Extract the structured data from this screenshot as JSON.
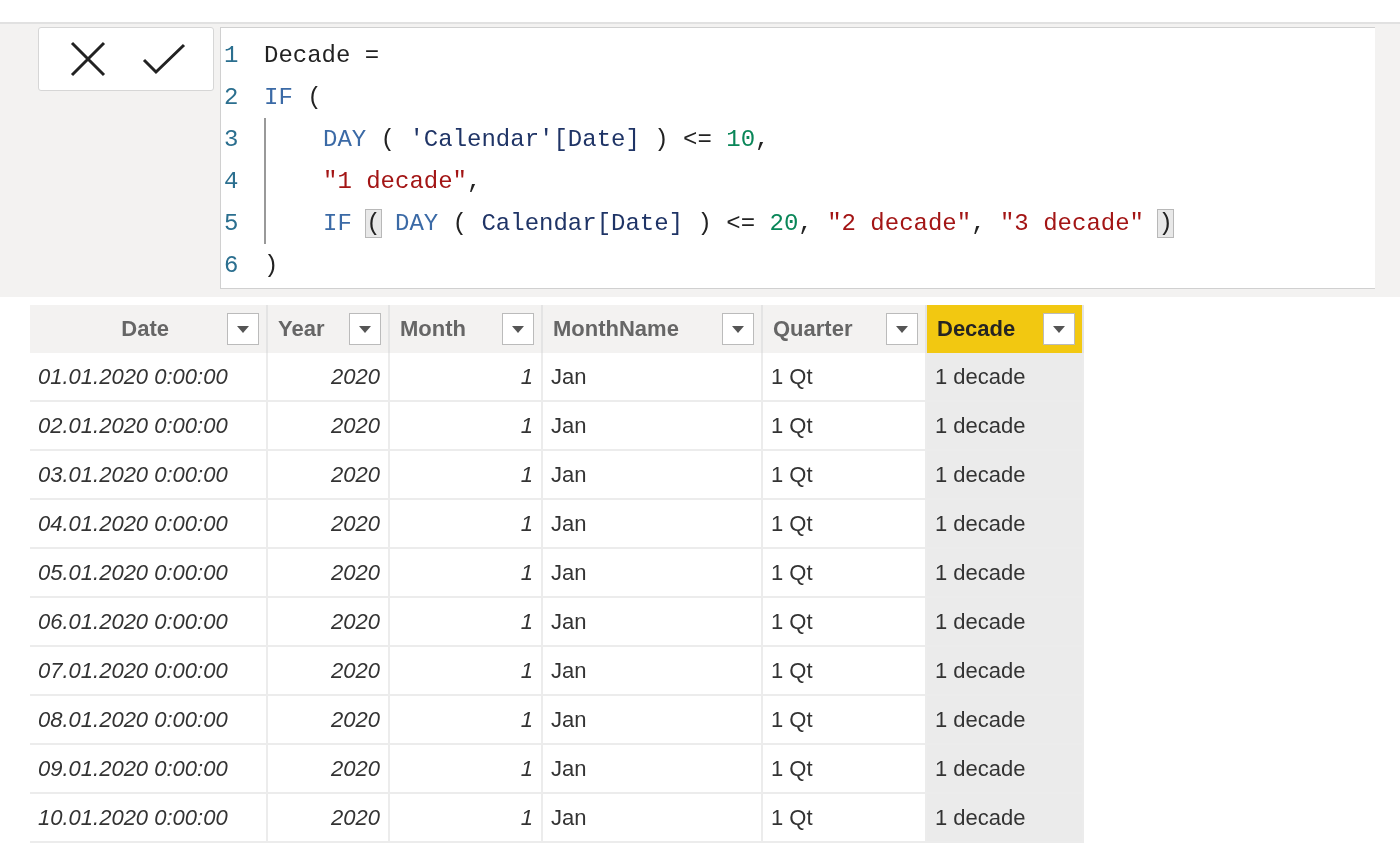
{
  "formula_bar": {
    "buttons": [
      {
        "kind": "cancel"
      },
      {
        "kind": "commit"
      }
    ],
    "lines": [
      {
        "number": "1",
        "guide": false,
        "tokens": [
          {
            "text": "Decade =",
            "kind": "text"
          }
        ]
      },
      {
        "number": "2",
        "guide": false,
        "tokens": [
          {
            "text": "IF",
            "kind": "keyword"
          },
          {
            "text": " (",
            "kind": "text"
          }
        ]
      },
      {
        "number": "3",
        "guide": true,
        "tokens": [
          {
            "text": "DAY",
            "kind": "keyword"
          },
          {
            "text": " ( ",
            "kind": "text"
          },
          {
            "text": "'Calendar'[Date]",
            "kind": "identifier"
          },
          {
            "text": " ) <= ",
            "kind": "text"
          },
          {
            "text": "10",
            "kind": "number"
          },
          {
            "text": ",",
            "kind": "text"
          }
        ]
      },
      {
        "number": "4",
        "guide": true,
        "tokens": [
          {
            "text": "\"1 decade\"",
            "kind": "string"
          },
          {
            "text": ",",
            "kind": "text"
          }
        ]
      },
      {
        "number": "5",
        "guide": true,
        "tokens": [
          {
            "text": "IF",
            "kind": "keyword"
          },
          {
            "text": "(",
            "kind": "bracket"
          },
          {
            "text": "DAY",
            "kind": "keyword"
          },
          {
            "text": " ( ",
            "kind": "text"
          },
          {
            "text": "Calendar[Date]",
            "kind": "identifier"
          },
          {
            "text": " ) <= ",
            "kind": "text"
          },
          {
            "text": "20",
            "kind": "number"
          },
          {
            "text": ", ",
            "kind": "text"
          },
          {
            "text": "\"2 decade\"",
            "kind": "string"
          },
          {
            "text": ", ",
            "kind": "text"
          },
          {
            "text": "\"3 decade\"",
            "kind": "string"
          },
          {
            "text": ")",
            "kind": "bracket"
          }
        ]
      },
      {
        "number": "6",
        "guide": false,
        "tokens": [
          {
            "text": ")",
            "kind": "text"
          }
        ]
      }
    ]
  },
  "table": {
    "columns": [
      {
        "label": "Date",
        "selected": false
      },
      {
        "label": "Year",
        "selected": false
      },
      {
        "label": "Month",
        "selected": false
      },
      {
        "label": "MonthName",
        "selected": false
      },
      {
        "label": "Quarter",
        "selected": false
      },
      {
        "label": "Decade",
        "selected": true
      }
    ],
    "rows": [
      [
        "01.01.2020 0:00:00",
        "2020",
        "1",
        "Jan",
        "1 Qt",
        "1 decade"
      ],
      [
        "02.01.2020 0:00:00",
        "2020",
        "1",
        "Jan",
        "1 Qt",
        "1 decade"
      ],
      [
        "03.01.2020 0:00:00",
        "2020",
        "1",
        "Jan",
        "1 Qt",
        "1 decade"
      ],
      [
        "04.01.2020 0:00:00",
        "2020",
        "1",
        "Jan",
        "1 Qt",
        "1 decade"
      ],
      [
        "05.01.2020 0:00:00",
        "2020",
        "1",
        "Jan",
        "1 Qt",
        "1 decade"
      ],
      [
        "06.01.2020 0:00:00",
        "2020",
        "1",
        "Jan",
        "1 Qt",
        "1 decade"
      ],
      [
        "07.01.2020 0:00:00",
        "2020",
        "1",
        "Jan",
        "1 Qt",
        "1 decade"
      ],
      [
        "08.01.2020 0:00:00",
        "2020",
        "1",
        "Jan",
        "1 Qt",
        "1 decade"
      ],
      [
        "09.01.2020 0:00:00",
        "2020",
        "1",
        "Jan",
        "1 Qt",
        "1 decade"
      ],
      [
        "10.01.2020 0:00:00",
        "2020",
        "1",
        "Jan",
        "1 Qt",
        "1 decade"
      ]
    ]
  }
}
